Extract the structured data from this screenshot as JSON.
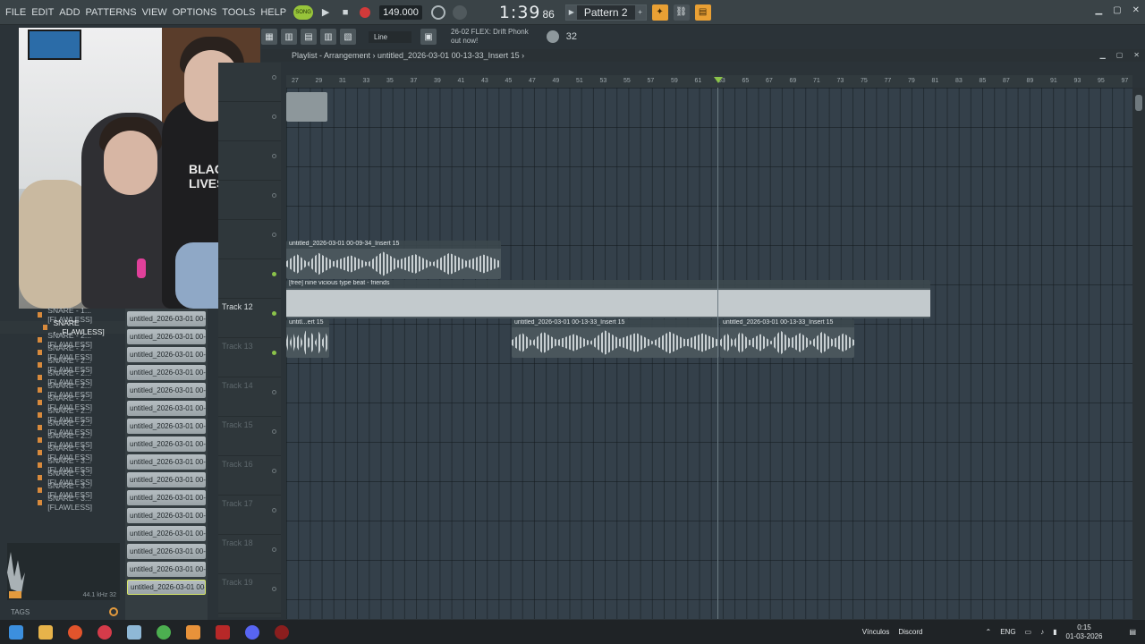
{
  "menu": {
    "items": [
      "FILE",
      "EDIT",
      "ADD",
      "PATTERNS",
      "VIEW",
      "OPTIONS",
      "TOOLS",
      "HELP"
    ]
  },
  "transport": {
    "song_label": "SONG",
    "tempo": "149.000",
    "time": "1:39",
    "time_cs": "86",
    "pattern": "Pattern 2"
  },
  "toolbar2": {
    "snap": "Line",
    "news_line1": "26-02  FLEX: Drift Phonk",
    "news_line2": "out now!",
    "digits": "32"
  },
  "playlist": {
    "title": "Playlist - Arrangement  › untitled_2026-03-01 00-13-33_Insert 15 ›",
    "ruler": [
      "27",
      "29",
      "31",
      "33",
      "35",
      "37",
      "39",
      "41",
      "43",
      "45",
      "47",
      "49",
      "51",
      "53",
      "55",
      "57",
      "59",
      "61",
      "63",
      "65",
      "67",
      "69",
      "71",
      "73",
      "75",
      "77",
      "79",
      "81",
      "83",
      "85",
      "87",
      "89",
      "91",
      "93",
      "95",
      "97"
    ],
    "clips": {
      "c1": "untitled_2026-03-01 00-09-34_Insert 15",
      "c2": "[free] nine vicious type beat - friends",
      "c3": "untitl...ert 15",
      "c4": "untitled_2026-03-01 00-13-33_Insert 15",
      "c5": "untitled_2026-03-01 00-13-33_Insert 15"
    }
  },
  "tracks": [
    "Track 12",
    "Track 13",
    "Track 14",
    "Track 15",
    "Track 16",
    "Track 17",
    "Track 18",
    "Track 19"
  ],
  "browser": {
    "items": [
      "SNARE - 1...[FLAWLESS]",
      "SNARE -...FLAWLESS]",
      "SNARE - 2...[FLAWLESS]",
      "SNARE - 2...[FLAWLESS]",
      "SNARE - 2...[FLAWLESS]",
      "SNARE - 2...[FLAWLESS]",
      "SNARE - 2...[FLAWLESS]",
      "SNARE - 2...[FLAWLESS]",
      "SNARE - 2...[FLAWLESS]",
      "SNARE - 2...[FLAWLESS]",
      "SNARE - 2...[FLAWLESS]",
      "SNARE - 3...[FLAWLESS]",
      "SNARE - 3...[FLAWLESS]",
      "SNARE - 3...[FLAWLESS]",
      "SNARE - 3...[FLAWLESS]",
      "SNARE - 3...[FLAWLESS]"
    ],
    "wave_info": "44.1 kHz 32",
    "tags": "TAGS"
  },
  "cliplist": [
    "untitled_2026-03-01 00-",
    "untitled_2026-03-01 00-",
    "untitled_2026-03-01 00-",
    "untitled_2026-03-01 00-",
    "untitled_2026-03-01 00-",
    "untitled_2026-03-01 00-",
    "untitled_2026-03-01 00-",
    "untitled_2026-03-01 00-",
    "untitled_2026-03-01 00-",
    "untitled_2026-03-01 00-",
    "untitled_2026-03-01 00-",
    "untitled_2026-03-01 00-",
    "untitled_2026-03-01 00-",
    "untitled_2026-03-01 00-",
    "untitled_2026-03-01 00-",
    "untitled_2026-03-01 00-"
  ],
  "webcam": {
    "shirt": "BLACK LIVES"
  },
  "taskbar": {
    "vinculos": "Vínculos",
    "discord": "Discord",
    "lang": "ENG",
    "time": "0:15",
    "date": "01-03-2026"
  }
}
